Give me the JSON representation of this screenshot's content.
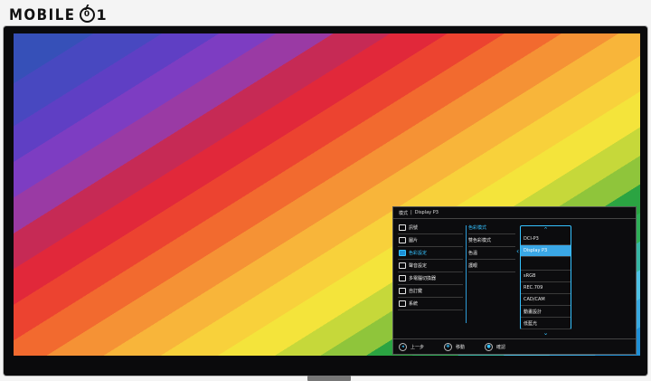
{
  "logo": {
    "text": "MOBILE",
    "badge": "0",
    "suffix": "1"
  },
  "osd": {
    "header": {
      "mode_label": "模式",
      "divider": "|",
      "mode_value": "Display P3"
    },
    "main_menu": [
      {
        "label": "訊號",
        "icon": "input-icon",
        "active": false
      },
      {
        "label": "圖片",
        "icon": "picture-icon",
        "active": false
      },
      {
        "label": "色彩設定",
        "icon": "color-icon",
        "active": true
      },
      {
        "label": "聲音設定",
        "icon": "audio-icon",
        "active": false
      },
      {
        "label": "多電腦切換器",
        "icon": "kvm-icon",
        "active": false
      },
      {
        "label": "自訂鍵",
        "icon": "custom-key-icon",
        "active": false
      },
      {
        "label": "系統",
        "icon": "system-icon",
        "active": false
      }
    ],
    "sub_menu": [
      {
        "label": "色彩模式",
        "active": true
      },
      {
        "label": "雙色彩模式",
        "active": false
      },
      {
        "label": "色溫",
        "active": false
      },
      {
        "label": "護眼",
        "active": false
      }
    ],
    "options": {
      "up_arrow": "⌃",
      "down_arrow": "⌄",
      "items": [
        {
          "label": "DCI-P3",
          "selected": false
        },
        {
          "label": "Display P3",
          "selected": true
        },
        {
          "label": "",
          "selected": false
        },
        {
          "label": "sRGB",
          "selected": false
        },
        {
          "label": "REC.709",
          "selected": false
        },
        {
          "label": "CAD/CAM",
          "selected": false
        },
        {
          "label": "動畫設計",
          "selected": false
        },
        {
          "label": "低藍光",
          "selected": false
        }
      ]
    },
    "footer": {
      "prev": "上一步",
      "move": "移動",
      "confirm": "確認"
    }
  },
  "colors": {
    "accent": "#35c2ff",
    "selected_bg": "#3aa7e6",
    "osd_bg": "#0c0c0e"
  }
}
